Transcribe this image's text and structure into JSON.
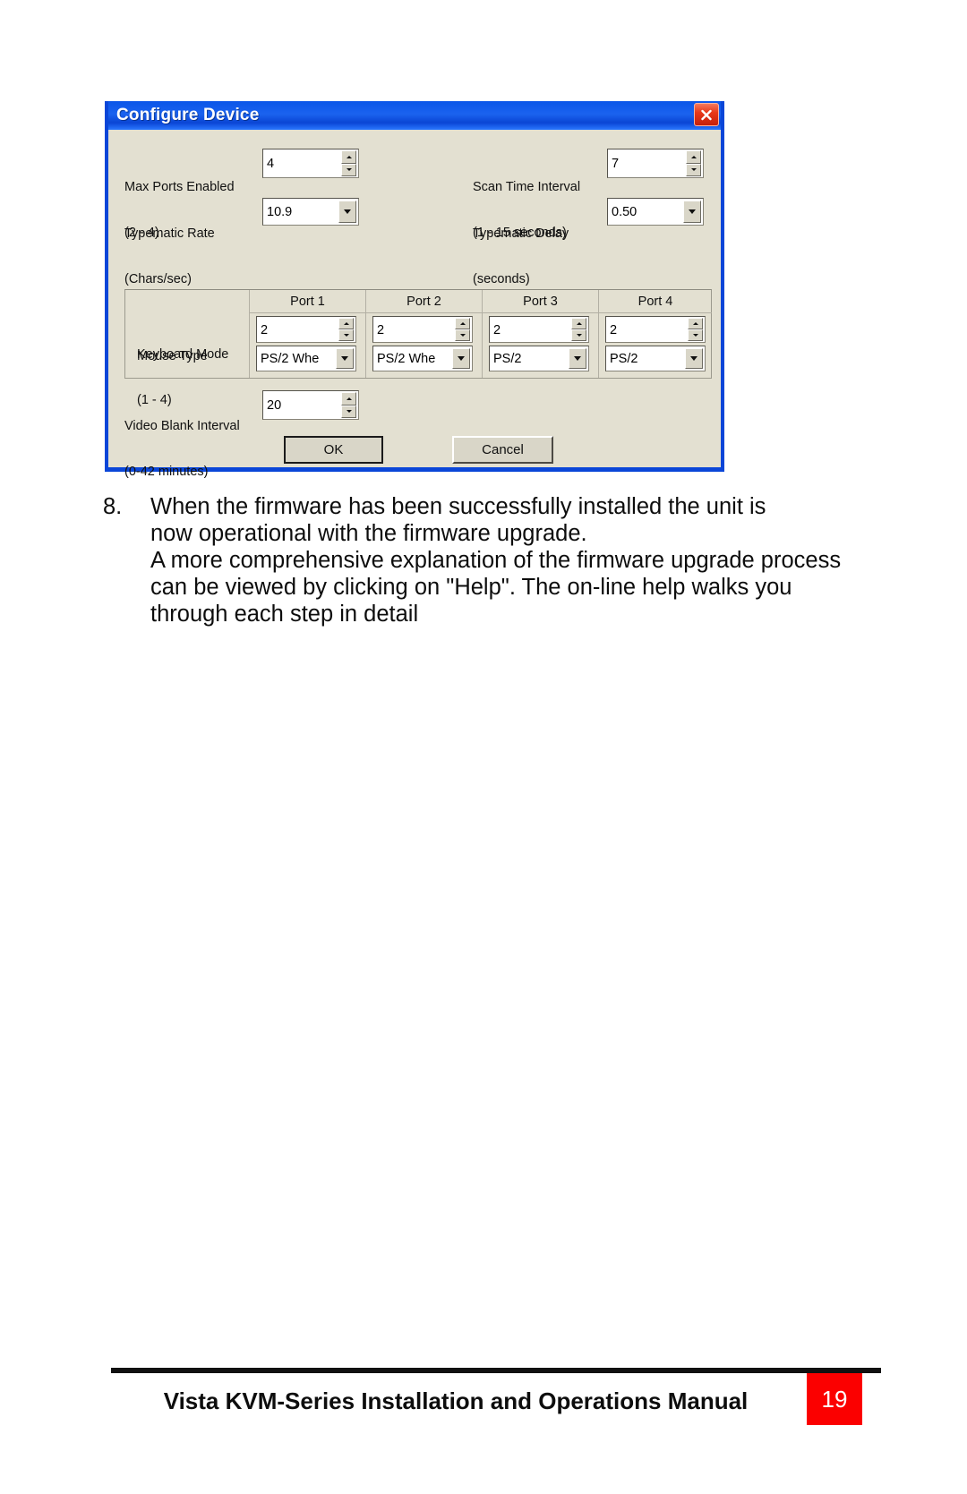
{
  "dialog": {
    "title": "Configure Device",
    "close_icon": "close-x-icon",
    "fields": {
      "max_ports": {
        "label_line1": "Max Ports Enabled",
        "label_line2": "(2 - 4)",
        "value": "4",
        "control": "spinner"
      },
      "scan_time": {
        "label_line1": "Scan Time Interval",
        "label_line2": "(1 - 15 seconds)",
        "value": "7",
        "control": "spinner"
      },
      "typematic_rate": {
        "label_line1": "Typematic Rate",
        "label_line2": "(Chars/sec)",
        "value": "10.9",
        "control": "combo"
      },
      "typematic_delay": {
        "label_line1": "Typematic Delay",
        "label_line2": "(seconds)",
        "value": "0.50",
        "control": "combo"
      },
      "video_blank": {
        "label_line1": "Video Blank Interval",
        "label_line2": "(0-42 minutes)",
        "value": "20",
        "control": "spinner"
      }
    },
    "ports_table": {
      "column_headers": [
        "Port 1",
        "Port 2",
        "Port 3",
        "Port 4"
      ],
      "row_labels": {
        "keyboard_mode_line1": "Keyboard Mode",
        "keyboard_mode_line2": "(1 - 4)",
        "mouse_type": "Mouse Type"
      },
      "keyboard_mode_values": [
        "2",
        "2",
        "2",
        "2"
      ],
      "mouse_type_values": [
        "PS/2 Whe",
        "PS/2 Whe",
        "PS/2",
        "PS/2"
      ]
    },
    "buttons": {
      "ok": "OK",
      "cancel": "Cancel"
    }
  },
  "content": {
    "step_number": "8.",
    "line1": "When the firmware has been successfully installed the unit is",
    "line2": "now operational with the firmware upgrade.",
    "line3": "A more comprehensive explanation of the firmware upgrade process",
    "line4": "can be viewed by clicking on \"Help\".  The on-line help walks you",
    "line5": "through each step in detail"
  },
  "footer": {
    "title": "Vista KVM-Series Installation and Operations Manual",
    "page_number": "19",
    "accent_color": "#fb0000"
  }
}
